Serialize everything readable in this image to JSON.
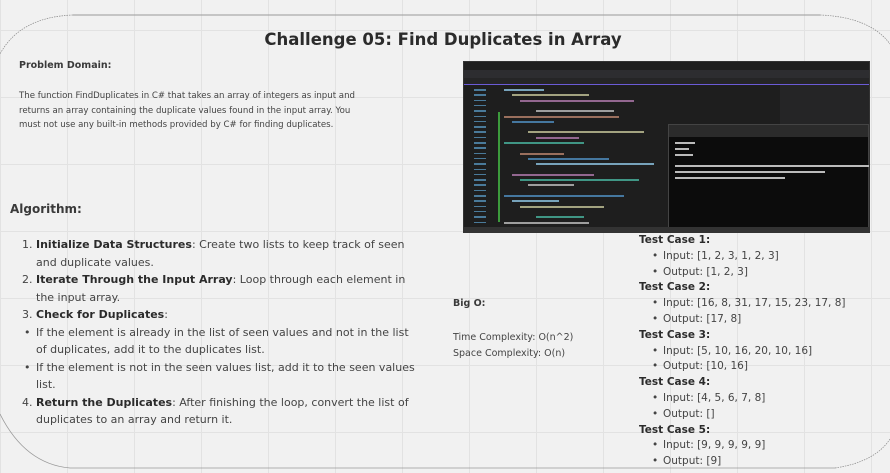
{
  "title": "Challenge 05: Find Duplicates in Array",
  "problem_domain": {
    "heading": "Problem Domain:",
    "text": "The function FindDuplicates in C# that takes an array of integers as input and returns an array containing the duplicate values found in the input array. You must not use any built-in methods provided by C# for finding duplicates."
  },
  "algorithm": {
    "heading": "Algorithm:",
    "steps": [
      {
        "marker": "1.",
        "bold": "Initialize Data Structures",
        "text": ": Create two lists to keep track of seen and duplicate values."
      },
      {
        "marker": "2.",
        "bold": "Iterate Through the Input Array",
        "text": ": Loop through each element in the input array."
      },
      {
        "marker": "3.",
        "bold": "Check for Duplicates",
        "text": ":"
      },
      {
        "marker": "•",
        "bold": "",
        "text": "If the element is already in the list of seen values and not in the list of duplicates, add it to the duplicates list."
      },
      {
        "marker": "•",
        "bold": "",
        "text": "If the element is not in the seen values list, add it to the seen values list."
      },
      {
        "marker": "4.",
        "bold": "Return the Duplicates",
        "text": ": After finishing the loop, convert the list of duplicates to an array and return it."
      }
    ]
  },
  "big_o": {
    "heading": "Big O:",
    "time": "Time Complexity: O(n^2)",
    "space": "Space Complexity: O(n)"
  },
  "test_cases": [
    {
      "title": "Test Case 1",
      "input": "Input: [1, 2, 3, 1, 2, 3]",
      "output": "Output: [1, 2, 3]"
    },
    {
      "title": "Test Case 2",
      "input": "Input: [16, 8, 31, 17, 15, 23, 17, 8]",
      "output": "Output: [17, 8]"
    },
    {
      "title": "Test Case 3",
      "input": "Input: [5, 10, 16, 20, 10, 16]",
      "output": "Output: [10, 16]"
    },
    {
      "title": "Test Case 4",
      "input": "Input: [4, 5, 6, 7, 8]",
      "output": "Output: []"
    },
    {
      "title": "Test Case 5",
      "input": "Input: [9, 9, 9, 9, 9]",
      "output": "Output: [9]"
    }
  ],
  "screenshot": {
    "icon": "ide-screenshot-image",
    "theme": "#1e1e1e"
  }
}
